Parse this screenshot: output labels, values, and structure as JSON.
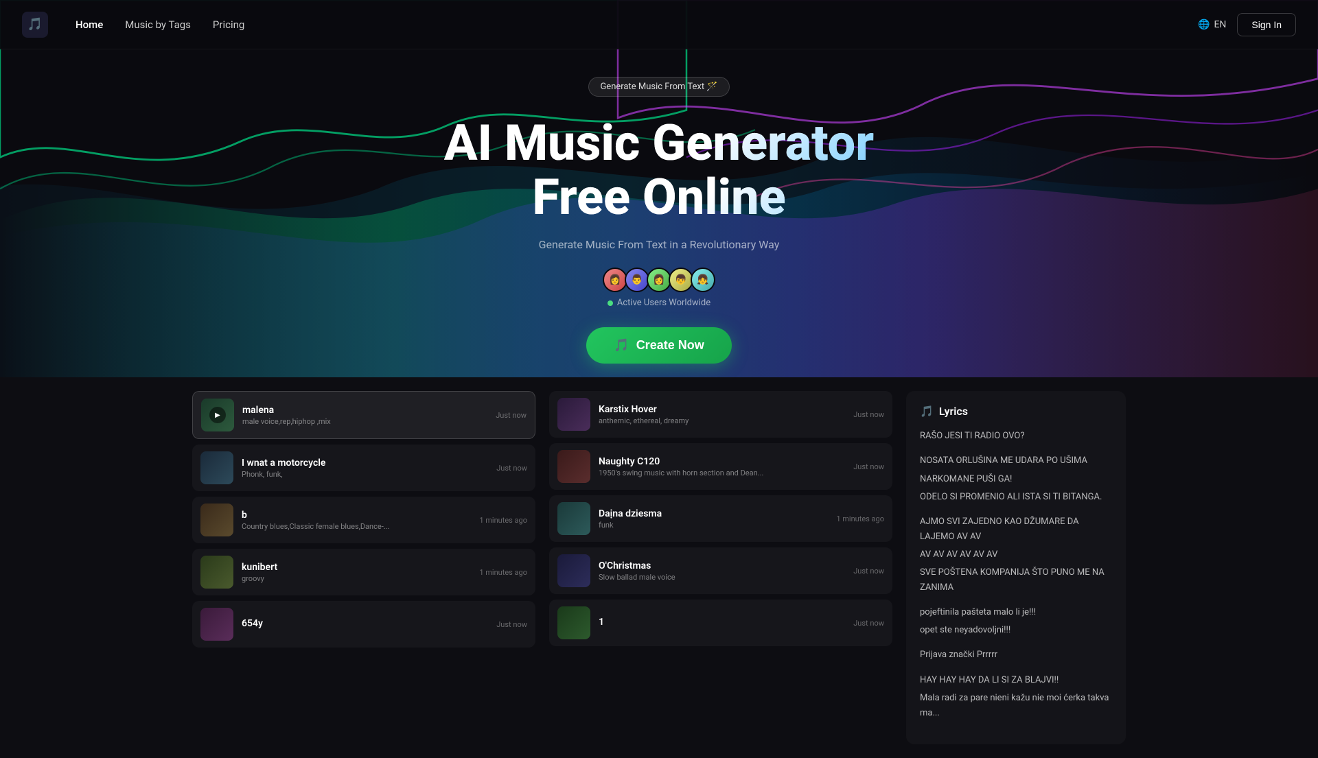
{
  "navbar": {
    "logo_icon": "🎵",
    "links": [
      {
        "label": "Home",
        "active": true
      },
      {
        "label": "Music by Tags",
        "active": false
      },
      {
        "label": "Pricing",
        "active": false
      }
    ],
    "lang": "EN",
    "sign_in": "Sign In"
  },
  "hero": {
    "badge": "Generate Music From Text 🪄",
    "title_line1": "AI Music Generator",
    "title_line2": "Free Online",
    "subtitle": "Generate Music From Text in a Revolutionary Way",
    "active_users_label": "Active Users Worldwide",
    "create_btn": "Create Now",
    "avatars": [
      "👩",
      "👨",
      "👩",
      "👦",
      "👧"
    ]
  },
  "songs_left": [
    {
      "title": "malena",
      "tags": "male voice,rep,hiphop ,mix",
      "time": "Just now",
      "thumb_class": "thumb-1",
      "active": true
    },
    {
      "title": "I wnat a motorcycle",
      "tags": "Phonk, funk,",
      "time": "Just now",
      "thumb_class": "thumb-3",
      "active": false
    },
    {
      "title": "b",
      "tags": "Country blues,Classic female blues,Dance-...",
      "time": "1 minutes ago",
      "thumb_class": "thumb-5",
      "active": false
    },
    {
      "title": "kunibert",
      "tags": "groovy",
      "time": "1 minutes ago",
      "thumb_class": "thumb-7",
      "active": false
    },
    {
      "title": "654y",
      "tags": "",
      "time": "Just now",
      "thumb_class": "thumb-9",
      "active": false
    }
  ],
  "songs_right": [
    {
      "title": "Karstix Hover",
      "tags": "anthemic, ethereal, dreamy",
      "time": "Just now",
      "thumb_class": "thumb-2",
      "active": false
    },
    {
      "title": "Naughty C120",
      "tags": "1950's swing music with horn section and Dean...",
      "time": "Just now",
      "thumb_class": "thumb-4",
      "active": false
    },
    {
      "title": "Daịna dziesma",
      "tags": "funk",
      "time": "1 minutes ago",
      "thumb_class": "thumb-6",
      "active": false
    },
    {
      "title": "O'Christmas",
      "tags": "Slow ballad male voice",
      "time": "Just now",
      "thumb_class": "thumb-8",
      "active": false
    },
    {
      "title": "1",
      "tags": "",
      "time": "Just now",
      "thumb_class": "thumb-10",
      "active": false
    }
  ],
  "lyrics": {
    "title": "Lyrics",
    "stanzas": [
      {
        "lines": [
          "RAŠO JESI TI RADIO OVO?"
        ]
      },
      {
        "lines": [
          "NOSATA ORLUŠINA ME UDARA PO UŠIMA",
          "NARKOMANE PUŠI GA!",
          "ODELO SI PROMENIO ALI ISTA SI TI BITANGA."
        ]
      },
      {
        "lines": [
          "AJMO SVI ZAJEDNO KAO DŽUMARE DA LAJEMO AV AV",
          "AV AV AV AV AV AV",
          "SVE POŠTENA KOMPANIJA ŠTO PUNO ME NA ZANIMA"
        ]
      },
      {
        "lines": [
          "pojeftinila pašteta malo li je!!!",
          "opet ste neyadovoljni!!!"
        ]
      },
      {
        "lines": [
          "Prijava znački Prrrrr"
        ]
      },
      {
        "lines": [
          "HAY HAY HAY DA LI SI ZA BLAJVI!!",
          "Mala radi za pare nieni kažu nie moi ćerka takva ma..."
        ]
      }
    ]
  }
}
